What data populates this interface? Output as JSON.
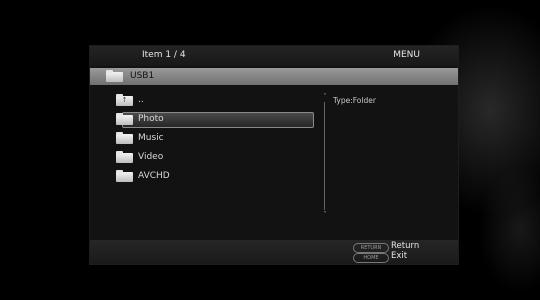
{
  "header": {
    "item_count": "Item  1  /  4",
    "menu": "MENU"
  },
  "path": {
    "label": "USB1",
    "icon": "folder-icon"
  },
  "items": [
    {
      "label": "..",
      "icon": "folder-up-icon",
      "glyph": "↑",
      "selected": false
    },
    {
      "label": "Photo",
      "icon": "folder-icon",
      "selected": true
    },
    {
      "label": "Music",
      "icon": "folder-icon",
      "selected": false
    },
    {
      "label": "Video",
      "icon": "folder-icon",
      "selected": false
    },
    {
      "label": "AVCHD",
      "icon": "folder-icon",
      "selected": false
    }
  ],
  "info": {
    "type": "Type:Folder"
  },
  "scroll": {
    "up": "˄",
    "down": "˅"
  },
  "footer": {
    "return_key": "RETURN",
    "return_label": "Return",
    "home_key": "HOME",
    "exit_label": "Exit"
  },
  "colors": {
    "background": "#000000",
    "panel": "#121212",
    "path_bar": "#8a8a8a",
    "text": "#e6e6e6"
  }
}
